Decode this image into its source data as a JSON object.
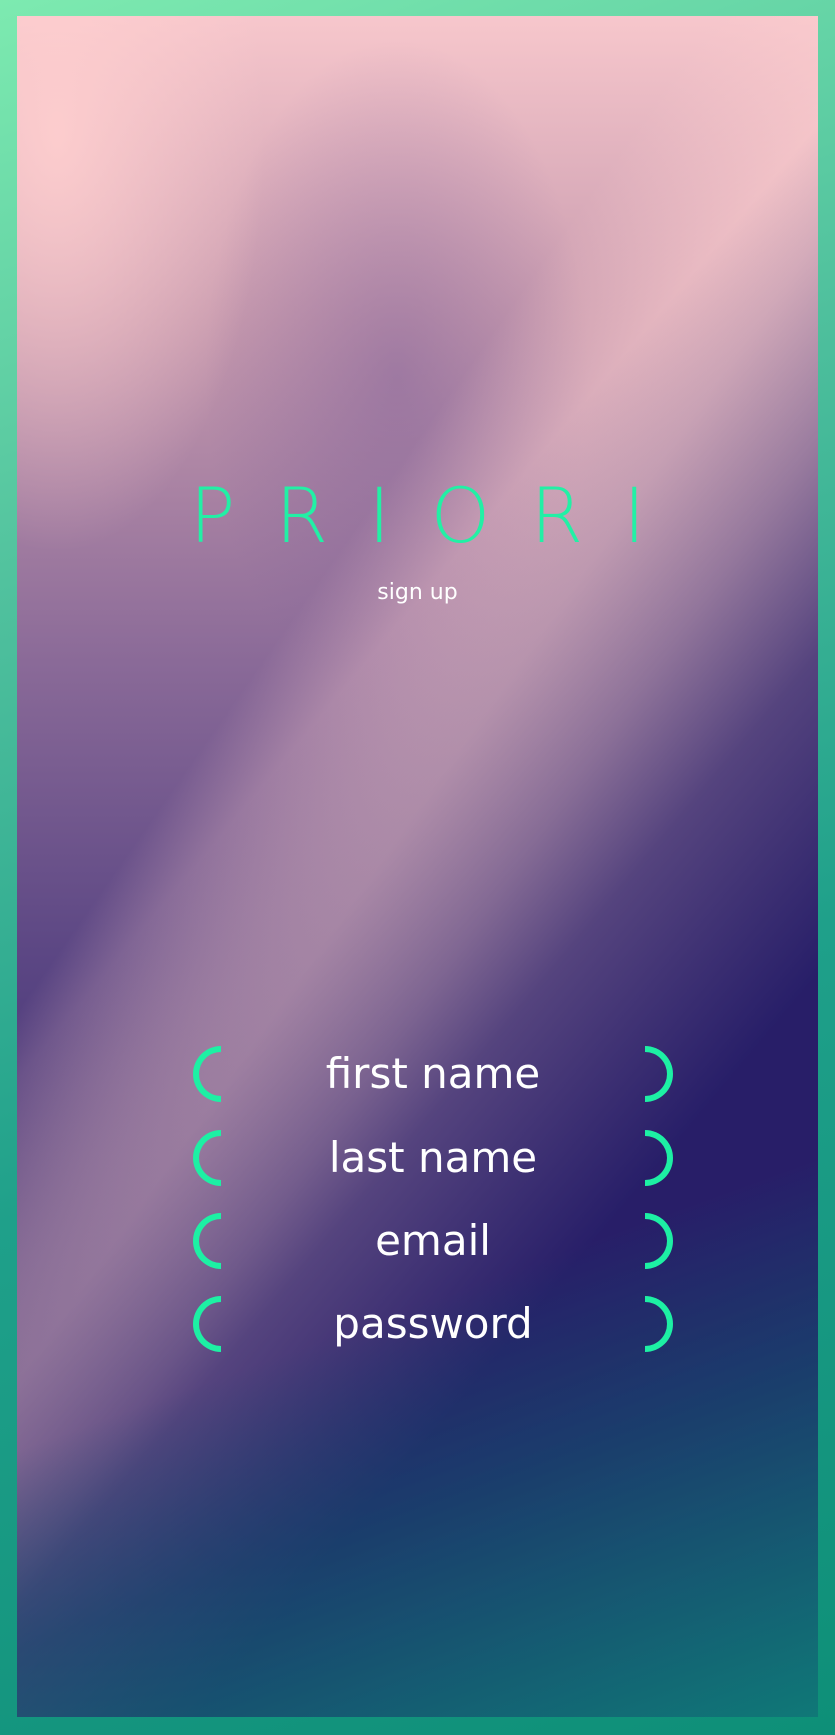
{
  "app": {
    "brand": "PRIORI",
    "subtitle": "sign up"
  },
  "form": {
    "fields": [
      {
        "label": "first name"
      },
      {
        "label": "last name"
      },
      {
        "label": "email"
      },
      {
        "label": "password"
      }
    ]
  },
  "colors": {
    "accent": "#1df0a4",
    "frame": "#2fb395",
    "text": "#ffffff",
    "background_top": "#ffcfcf",
    "background_bottom": "#1c1563"
  }
}
